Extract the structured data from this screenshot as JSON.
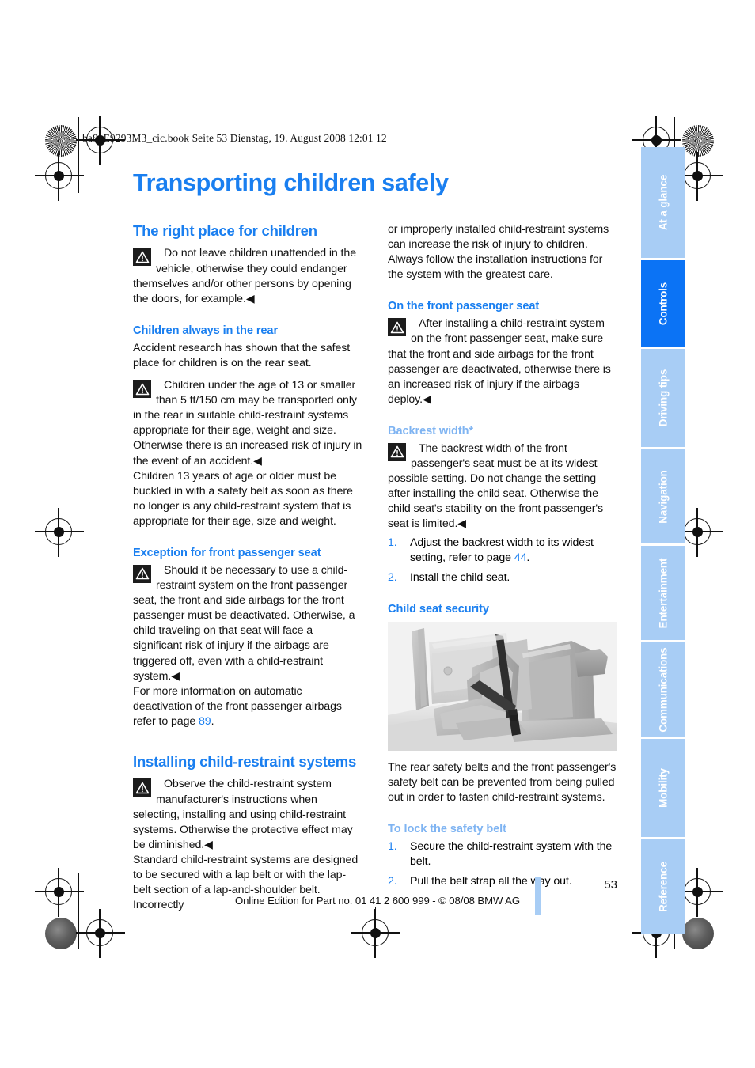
{
  "running_head": "ba8_E9293M3_cic.book  Seite 53  Dienstag, 19. August 2008  12:01 12",
  "chapter_title": "Transporting children safely",
  "colors": {
    "accent_blue": "#1a7ff0",
    "light_blue": "#7fb4f2",
    "tab_inactive": "#a8cdf5",
    "tab_active": "#0b73f5"
  },
  "left_column": {
    "section_1": {
      "heading": "The right place for children",
      "warning": {
        "icon": "warning-triangle-icon",
        "text": "Do not leave children unattended in the vehicle, otherwise they could endanger themselves and/or other persons by opening the doors, for example.",
        "endmark": "◀"
      },
      "sub_1": {
        "heading": "Children always in the rear",
        "para_1": "Accident research has shown that the safest place for children is on the rear seat.",
        "warning": {
          "icon": "warning-triangle-icon",
          "text": "Children under the age of 13 or smaller than 5 ft/150 cm may be transported only in the rear in suitable child-restraint systems appropriate for their age, weight and size. Otherwise there is an increased risk of injury in the event of an accident.",
          "endmark": "◀"
        },
        "para_2": "Children 13 years of age or older must be buckled in with a safety belt as soon as there no longer is any child-restraint system that is appropriate for their age, size and weight."
      },
      "sub_2": {
        "heading": "Exception for front passenger seat",
        "warning": {
          "icon": "warning-triangle-icon",
          "text": "Should it be necessary to use a child-restraint system on the front passenger seat, the front and side airbags for the front passenger must be deactivated. Otherwise, a child traveling on that seat will face a significant risk of injury if the airbags are triggered off, even with a child-restraint system.",
          "endmark": "◀"
        },
        "para_after_prefix": "For more information on automatic deactivation of the front passenger airbags refer to page ",
        "para_after_pageref": "89",
        "para_after_suffix": "."
      }
    },
    "section_2": {
      "heading": "Installing child-restraint systems",
      "warning": {
        "icon": "warning-triangle-icon",
        "text": "Observe the child-restraint system manufacturer's instructions when selecting, installing and using child-restraint systems. Otherwise the protective effect may be diminished.",
        "endmark": "◀"
      },
      "para_1": "Standard child-restraint systems are designed to be secured with a lap belt or with the lap-belt section of a lap-and-shoulder belt. Incorrectly"
    }
  },
  "right_column": {
    "continuation": "or improperly installed child-restraint systems can increase the risk of injury to children. Always follow the installation instructions for the system with the greatest care.",
    "sub_1": {
      "heading": "On the front passenger seat",
      "warning": {
        "icon": "warning-triangle-icon",
        "text": "After installing a child-restraint system on the front passenger seat, make sure that the front and side airbags for the front passenger are deactivated, otherwise there is an increased risk of injury if the airbags deploy.",
        "endmark": "◀"
      }
    },
    "sub_2": {
      "heading": "Backrest width*",
      "warning": {
        "icon": "warning-triangle-icon",
        "text": "The backrest width of the front passenger's seat must be at its widest possible setting. Do not change the setting after installing the child seat. Otherwise the child seat's stability on the front passenger's seat is limited.",
        "endmark": "◀"
      },
      "steps": [
        {
          "num": "1.",
          "text_prefix": "Adjust the backrest width to its widest setting, refer to page ",
          "pageref": "44",
          "text_suffix": "."
        },
        {
          "num": "2.",
          "text_prefix": "Install the child seat.",
          "pageref": "",
          "text_suffix": ""
        }
      ]
    },
    "sub_3": {
      "heading": "Child seat security",
      "figure": {
        "name": "child-seat-in-rear-seat-illustration",
        "alt": "Car rear interior with child seat secured by safety belt"
      },
      "caption": "The rear safety belts and the front passenger's safety belt can be prevented from being pulled out in order to fasten child-restraint systems."
    },
    "sub_4": {
      "heading": "To lock the safety belt",
      "steps": [
        {
          "num": "1.",
          "text_prefix": "Secure the child-restraint system with the belt.",
          "pageref": "",
          "text_suffix": ""
        },
        {
          "num": "2.",
          "text_prefix": "Pull the belt strap all the way out.",
          "pageref": "",
          "text_suffix": ""
        }
      ]
    }
  },
  "tabs": [
    {
      "label": "At a glance",
      "active": false
    },
    {
      "label": "Controls",
      "active": true
    },
    {
      "label": "Driving tips",
      "active": false
    },
    {
      "label": "Navigation",
      "active": false
    },
    {
      "label": "Entertainment",
      "active": false
    },
    {
      "label": "Communications",
      "active": false
    },
    {
      "label": "Mobility",
      "active": false
    },
    {
      "label": "Reference",
      "active": false
    }
  ],
  "footer": {
    "page_number": "53",
    "imprint": "Online Edition for Part no. 01 41 2 600 999 - © 08/08 BMW AG"
  }
}
